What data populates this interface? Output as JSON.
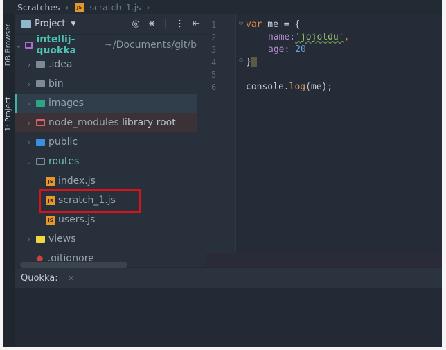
{
  "breadcrumb": {
    "items": [
      "Scratches",
      "scratch_1.js"
    ]
  },
  "sidebar_tabs": [
    "DB Browser",
    "1: Project"
  ],
  "project_panel": {
    "title": "Project",
    "tools": [
      "target-icon",
      "collapse-icon",
      "more-icon",
      "hide-icon"
    ],
    "tree": [
      {
        "label": "intellij-quokka",
        "suffix": "~/Documents/git/b",
        "kind": "root"
      },
      {
        "label": ".idea",
        "kind": "folder"
      },
      {
        "label": "bin",
        "kind": "folder"
      },
      {
        "label": "images",
        "kind": "folder-images",
        "selected": true
      },
      {
        "label": "node_modules",
        "suffix": "library root",
        "kind": "folder-lib"
      },
      {
        "label": "public",
        "kind": "folder-web"
      },
      {
        "label": "routes",
        "kind": "folder-open"
      },
      {
        "label": "index.js",
        "kind": "js"
      },
      {
        "label": "scratch_1.js",
        "kind": "js",
        "highlighted": true
      },
      {
        "label": "users.js",
        "kind": "js"
      },
      {
        "label": "views",
        "kind": "folder-views"
      },
      {
        "label": ".gitignore",
        "kind": "git"
      }
    ]
  },
  "editor": {
    "line_numbers": [
      "1",
      "2",
      "3",
      "4",
      "5",
      "6"
    ],
    "tokens": {
      "var": "var",
      "me_decl": " me = {",
      "name_key": "name:",
      "name_val": "'jojoldu'",
      "comma": ",",
      "age_key": "age:",
      "age_val": " 20",
      "close": "}",
      "console": "console.",
      "log": "log",
      "args": "(me);"
    }
  },
  "bottom_panel": {
    "title": "Quokka:",
    "close": "×"
  },
  "colors": {
    "highlight_box": "#d8141b",
    "js_badge": "#e6962a",
    "accent": "#3fb3a5"
  }
}
